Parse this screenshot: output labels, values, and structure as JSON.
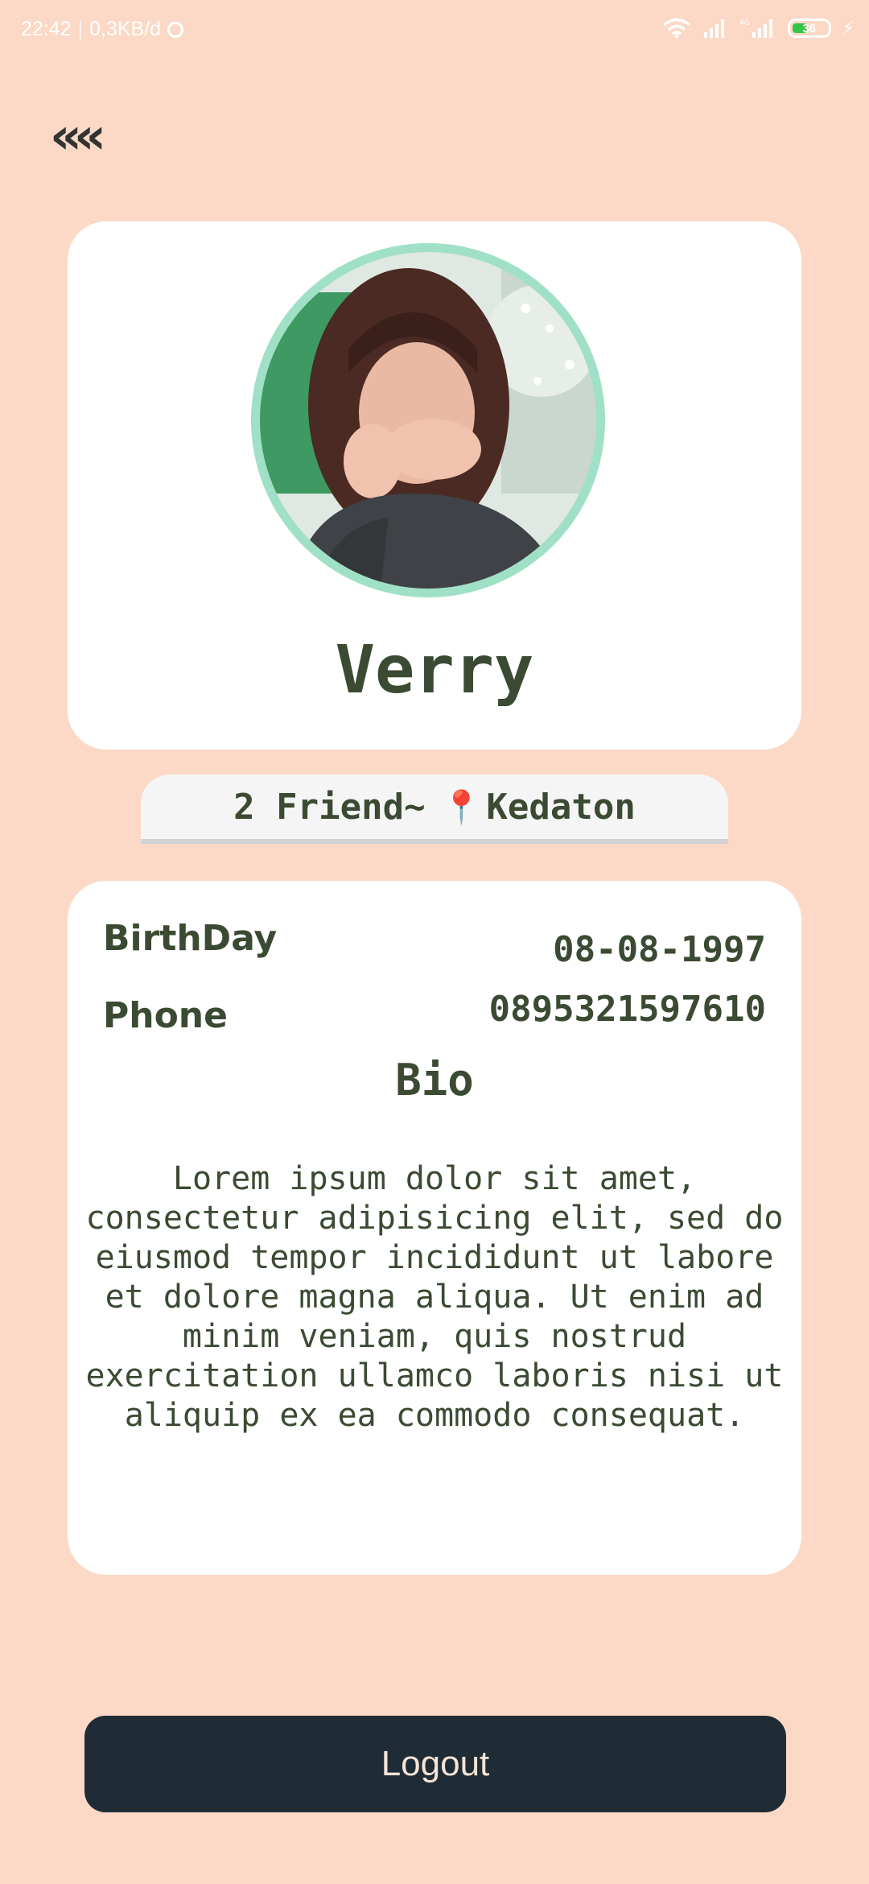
{
  "status_bar": {
    "time": "22:42",
    "net_speed": "0,3KB/d",
    "battery_level": "36",
    "icons": [
      "alarm-icon",
      "wifi-icon",
      "signal-icon",
      "signal-4g-icon",
      "battery-icon",
      "charging-icon"
    ]
  },
  "nav": {
    "back_label": "««"
  },
  "profile": {
    "name": "Verry",
    "friends": "2 Friend~",
    "location_icon": "📍",
    "location": "Kedaton"
  },
  "details": {
    "birthday_label": "BirthDay",
    "birthday_value": "08-08-1997",
    "phone_label": "Phone",
    "phone_value": "0895321597610"
  },
  "bio": {
    "title": "Bio",
    "text": "Lorem ipsum dolor sit amet, consectetur adipisicing elit, sed do eiusmod tempor incididunt ut labore et dolore magna aliqua. Ut enim ad minim veniam, quis nostrud exercitation ullamco laboris nisi ut aliquip ex ea commodo consequat."
  },
  "actions": {
    "logout_label": "Logout"
  },
  "colors": {
    "background": "#fbd9c6",
    "card": "#ffffff",
    "text": "#3b4a32",
    "avatar_ring": "#9fe0c6",
    "logout_button": "#1f2c36"
  }
}
